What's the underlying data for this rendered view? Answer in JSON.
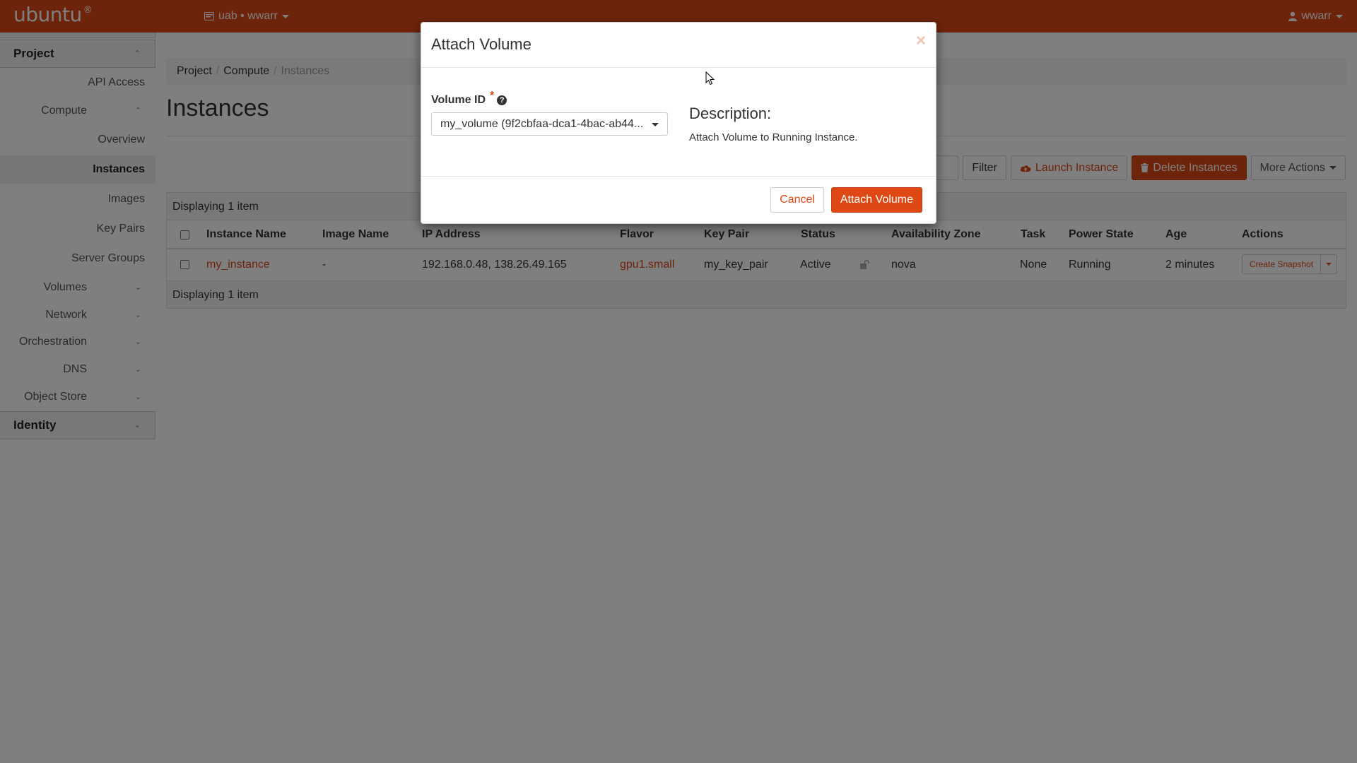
{
  "navbar": {
    "brand": "ubuntu",
    "brand_mark": "®",
    "project_menu": "uab • wwarr",
    "user_menu": "wwarr"
  },
  "sidebar": {
    "project_header": "Project",
    "api_access": "API Access",
    "compute": "Compute",
    "overview": "Overview",
    "instances": "Instances",
    "images": "Images",
    "key_pairs": "Key Pairs",
    "server_groups": "Server Groups",
    "volumes": "Volumes",
    "network": "Network",
    "orchestration": "Orchestration",
    "dns": "DNS",
    "object_store": "Object Store",
    "identity_header": "Identity"
  },
  "breadcrumb": {
    "items": [
      "Project",
      "Compute"
    ],
    "current": "Instances",
    "separator": "/"
  },
  "page": {
    "title": "Instances"
  },
  "toolbar": {
    "filter_label": "Filter",
    "launch_label": "Launch Instance",
    "delete_label": "Delete Instances",
    "more_label": "More Actions"
  },
  "table": {
    "caption": "Displaying 1 item",
    "footer": "Displaying 1 item",
    "headers": [
      "Instance Name",
      "Image Name",
      "IP Address",
      "Flavor",
      "Key Pair",
      "Status",
      "Availability Zone",
      "Task",
      "Power State",
      "Age",
      "Actions"
    ],
    "rows": [
      {
        "instance_name": "my_instance",
        "image_name": "-",
        "ip_address": "192.168.0.48, 138.26.49.165",
        "flavor": "gpu1.small",
        "key_pair": "my_key_pair",
        "status": "Active",
        "availability_zone": "nova",
        "task": "None",
        "power_state": "Running",
        "age": "2 minutes",
        "action_label": "Create Snapshot"
      }
    ]
  },
  "modal": {
    "title": "Attach Volume",
    "close": "×",
    "field_label": "Volume ID",
    "required_mark": "*",
    "help_icon": "?",
    "selected_value": "my_volume (9f2cbfaa-dca1-4bac-ab44...",
    "description_title": "Description:",
    "description_text": "Attach Volume to Running Instance.",
    "cancel_label": "Cancel",
    "attach_label": "Attach Volume"
  },
  "colors": {
    "brand": "#dd4814",
    "backdrop": "rgba(0,0,0,0.5)"
  },
  "icons": {
    "project_menu": "card-icon",
    "user_menu": "user-icon",
    "launch": "cloud-upload-icon",
    "delete": "trash-icon",
    "status_lock": "unlock-icon"
  }
}
